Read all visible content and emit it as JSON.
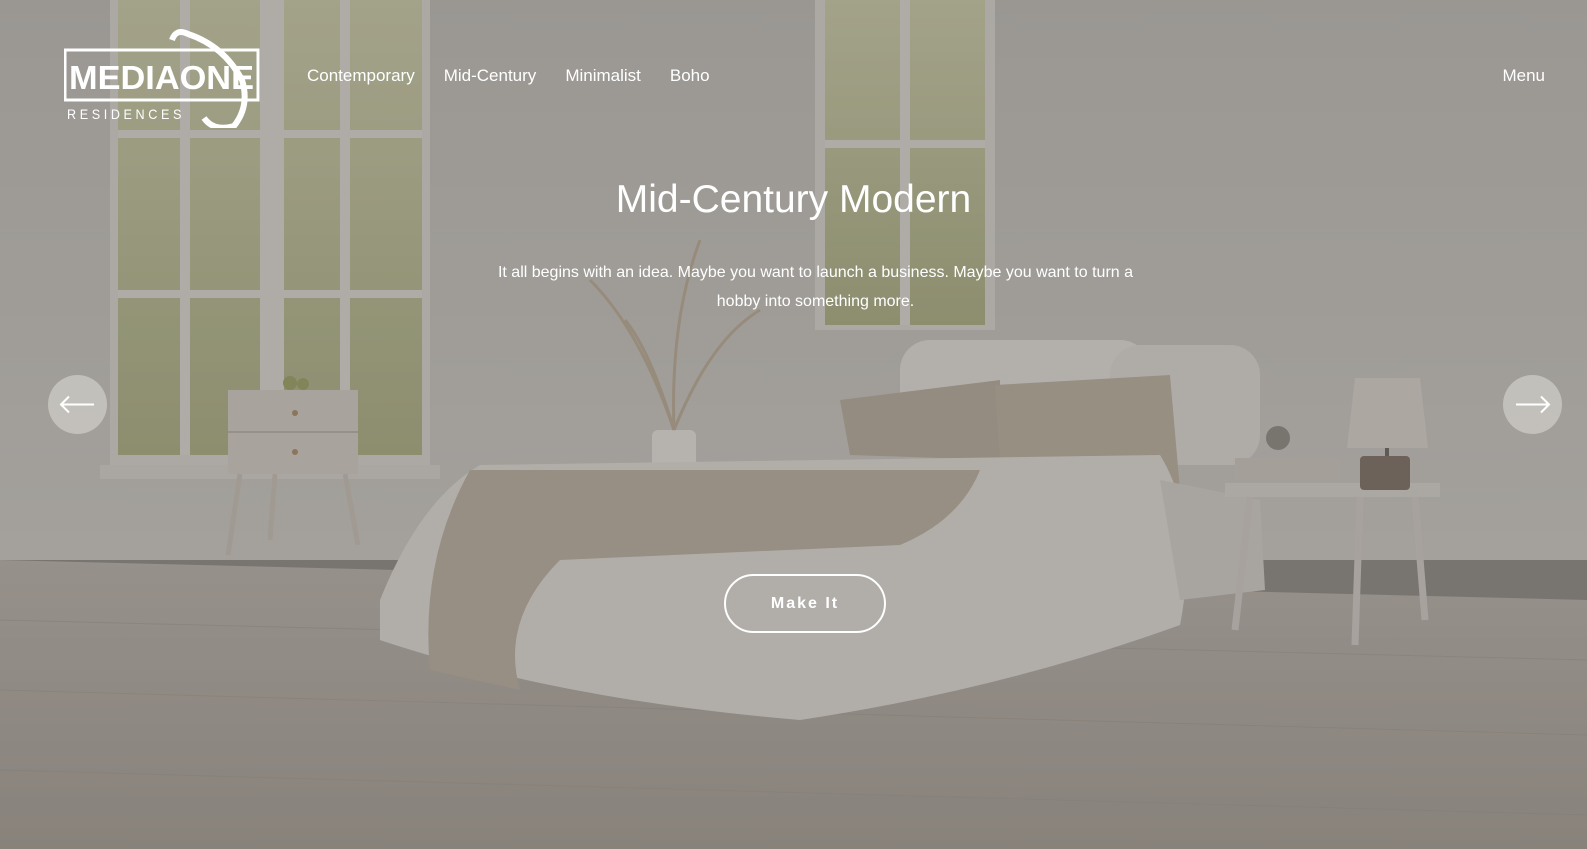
{
  "brand": {
    "logo_main": "MEDIAONE",
    "logo_sub": "RESIDENCES"
  },
  "nav": {
    "items": [
      {
        "label": "Contemporary"
      },
      {
        "label": "Mid-Century"
      },
      {
        "label": "Minimalist"
      },
      {
        "label": "Boho"
      }
    ],
    "menu_label": "Menu"
  },
  "hero": {
    "title": "Mid-Century Modern",
    "subtitle": "It all begins with an idea. Maybe you want to launch a business. Maybe you want to turn a hobby into something more.",
    "cta_label": "Make It",
    "prev_icon": "arrow-left-icon",
    "next_icon": "arrow-right-icon"
  },
  "colors": {
    "text": "#ffffff",
    "overlay": "#46423e",
    "arrow_bg": "#ebe8e4"
  }
}
